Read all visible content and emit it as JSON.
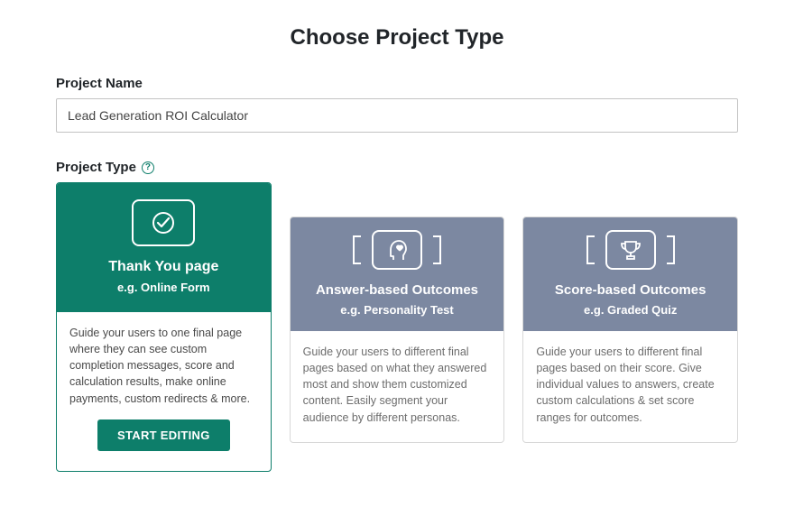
{
  "page_title": "Choose Project Type",
  "project_name": {
    "label": "Project Name",
    "value": "Lead Generation ROI Calculator"
  },
  "project_type": {
    "label": "Project Type"
  },
  "start_editing_label": "START EDITING",
  "cards": [
    {
      "title": "Thank You page",
      "subtitle": "e.g. Online Form",
      "desc": "Guide your users to one final page where they can see custom completion messages, score and calculation results, make online payments, custom redirects & more."
    },
    {
      "title": "Answer-based Outcomes",
      "subtitle": "e.g. Personality Test",
      "desc": "Guide your users to different final pages based on what they answered most and show them customized content. Easily segment your audience by different personas."
    },
    {
      "title": "Score-based Outcomes",
      "subtitle": "e.g. Graded Quiz",
      "desc": "Guide your users to different final pages based on their score. Give individual values to answers, create custom calculations & set score ranges for outcomes."
    }
  ]
}
